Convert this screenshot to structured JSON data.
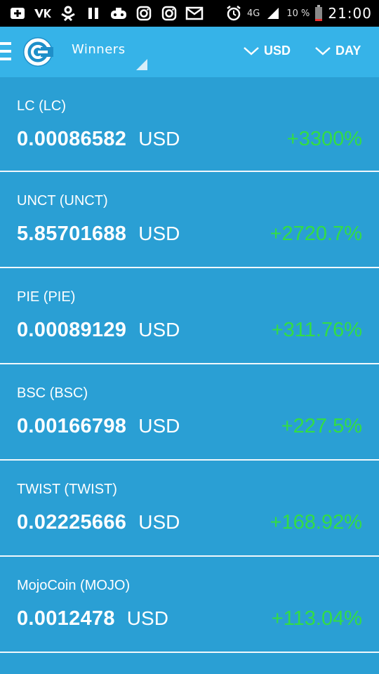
{
  "status_bar": {
    "battery_text": "10 %",
    "time": "21:00",
    "network": "4G"
  },
  "app_bar": {
    "filter_label": "Winners",
    "currency_label": "USD",
    "period_label": "DAY"
  },
  "coins": [
    {
      "name": "LC (LC)",
      "price": "0.00086582",
      "unit": "USD",
      "change": "+3300%"
    },
    {
      "name": "UNCT (UNCT)",
      "price": "5.85701688",
      "unit": "USD",
      "change": "+2720.7%"
    },
    {
      "name": "PIE (PIE)",
      "price": "0.00089129",
      "unit": "USD",
      "change": "+311.76%"
    },
    {
      "name": "BSC (BSC)",
      "price": "0.00166798",
      "unit": "USD",
      "change": "+227.5%"
    },
    {
      "name": "TWIST (TWIST)",
      "price": "0.02225666",
      "unit": "USD",
      "change": "+168.92%"
    },
    {
      "name": "MojoCoin (MOJO)",
      "price": "0.0012478",
      "unit": "USD",
      "change": "+113.04%"
    }
  ],
  "colors": {
    "appbar": "#36b3e8",
    "list_bg": "#2a9fd4",
    "positive": "#33dd44"
  }
}
